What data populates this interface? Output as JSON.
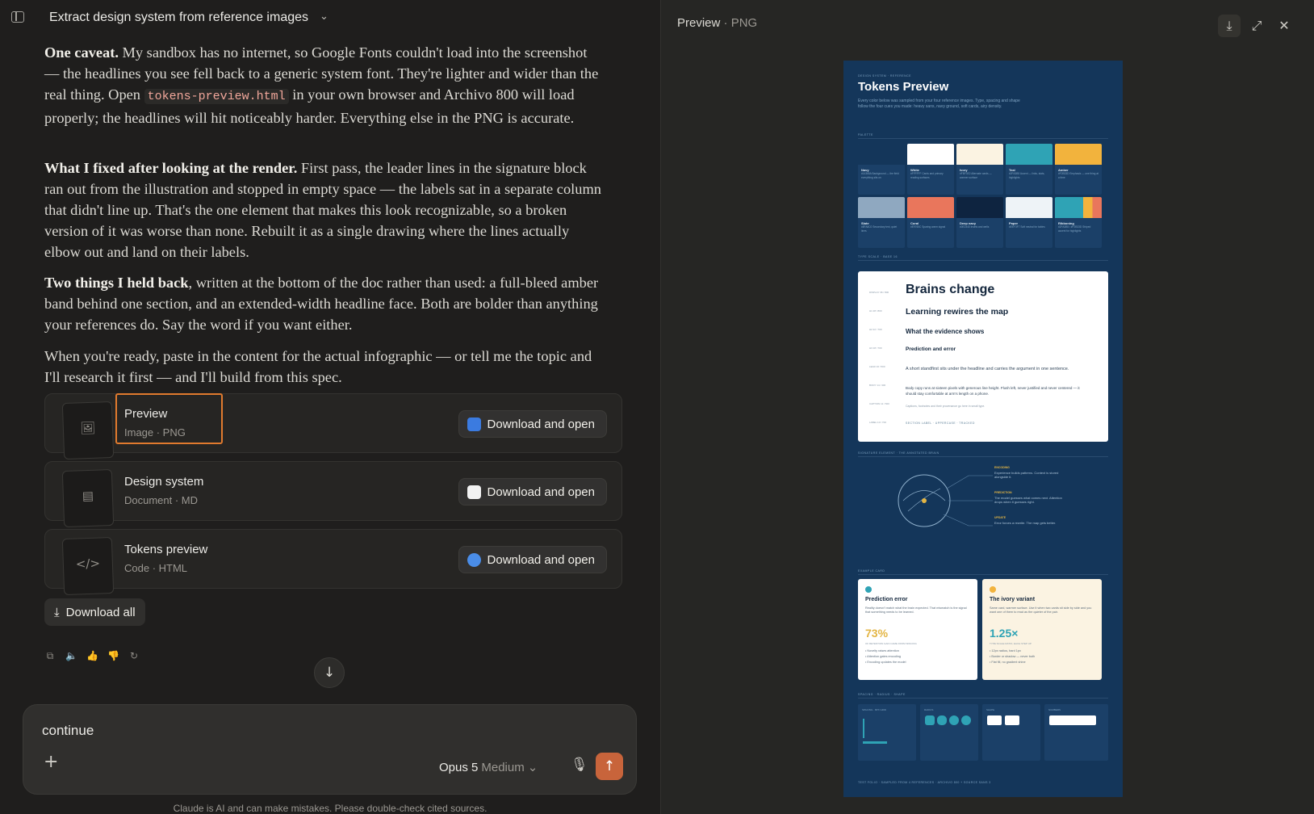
{
  "header": {
    "title": "Extract design system from reference images"
  },
  "messages": {
    "p1": {
      "lead": "One caveat.",
      "pre": " My sandbox has no internet, so Google Fonts couldn't load into the screenshot — the headlines you see fell back to a generic system font. They're lighter and wider than the real thing. Open ",
      "code": "tokens-preview.html",
      "post": " in your own browser and Archivo 800 will load properly; the headlines will hit noticeably harder. Everything else in the PNG is accurate."
    },
    "p2": {
      "lead": "What I fixed after looking at the render.",
      "body": " First pass, the leader lines in the signature block ran out from the illustration and stopped in empty space — the labels sat in a separate column that didn't line up. That's the one element that makes this look recognizable, so a broken version of it was worse than none. Rebuilt it as a single drawing where the lines actually elbow out and land on their labels."
    },
    "p3": {
      "lead": "Two things I held back",
      "body": ", written at the bottom of the doc rather than used: a full-bleed amber band behind one section, and an extended-width headline face. Both are bolder than anything your references do. Say the word if you want either."
    },
    "p4": {
      "body": "When you're ready, paste in the content for the actual infographic — or tell me the topic and I'll research it first — and I'll build from this spec."
    }
  },
  "files": [
    {
      "name": "Preview",
      "meta": "Image · PNG",
      "thumb_icon": "image-icon",
      "button": "Download and open",
      "app_color": "#3b7be0"
    },
    {
      "name": "Design system",
      "meta": "Document · MD",
      "thumb_icon": "document-icon",
      "button": "Download and open",
      "app_color": "#f2f2f2"
    },
    {
      "name": "Tokens preview",
      "meta": "Code · HTML",
      "thumb_icon": "code-icon",
      "button": "Download and open",
      "app_color": "#4a8de8"
    }
  ],
  "download_all": "Download all",
  "composer": {
    "value": "continue",
    "model": "Opus 5",
    "effort": "Medium"
  },
  "disclaimer": "Claude is AI and can make mistakes. Please double-check cited sources.",
  "preview_panel": {
    "title": "Preview",
    "subtitle": "PNG"
  },
  "poster": {
    "eyebrow": "DESIGN SYSTEM · REFERENCE",
    "title": "Tokens Preview",
    "intro": "Every color below was sampled from your four reference images. Type, spacing and shape follow the four cues you made: heavy sans, navy ground, soft cards, airy density.",
    "palette_label": "PALETTE",
    "swatches": [
      {
        "name": "Navy",
        "hex": "#14365A",
        "desc": "Background — the field everything sits on",
        "color": "#14365a"
      },
      {
        "name": "White",
        "hex": "#FFFFFF",
        "desc": "Cards and primary reading surfaces",
        "color": "#ffffff"
      },
      {
        "name": "Ivory",
        "hex": "#FBF3E2",
        "desc": "Alternate cards — warmer surface",
        "color": "#fbf3e2"
      },
      {
        "name": "Teal",
        "hex": "#2FA3B5",
        "desc": "Accent — links, stats, highlights",
        "color": "#2fa3b5"
      },
      {
        "name": "Amber",
        "hex": "#F2B33D",
        "desc": "Emphasis — one thing at a time",
        "color": "#f2b33d"
      },
      {
        "name": "Slate",
        "hex": "#8FA8C0",
        "desc": "Secondary text, quiet lines",
        "color": "#8fa8c0"
      },
      {
        "name": "Coral",
        "hex": "#E9765C",
        "desc": "Sparing warm signal",
        "color": "#e9765c"
      },
      {
        "name": "Deep navy",
        "hex": "#0E2440",
        "desc": "Insets and wells",
        "color": "#0e2440"
      },
      {
        "name": "Paper",
        "hex": "#EEF3F7",
        "desc": "Soft neutral for tables",
        "color": "#eef3f7"
      },
      {
        "name": "Ribboning",
        "hex": "#2FA3B5 / #F2B33D",
        "desc": "Striped accent for highlights",
        "color": "#2fa3b5"
      }
    ],
    "type_label": "TYPE SCALE · BASE 16",
    "type_sides": [
      "DISPLAY 36 / 800",
      "H1 28 / 800",
      "H2 22 / 700",
      "H3 18 / 700",
      "LEAD 16 / 500",
      "BODY 14 / 400",
      "CAPTION 11 / 500",
      "LABEL 10 / 700"
    ],
    "type_h1": "Brains change",
    "type_h2": "Learning rewires the map",
    "type_h3": "What the evidence shows",
    "type_h4": "Prediction and error",
    "type_lead": "A short standfirst sits under the headline and carries the argument in one sentence.",
    "type_body": "Body copy runs at sixteen pixels with generous line height. Flush left, never justified and never centered — it should stay comfortable at arm's length on a phone.",
    "type_caption": "Captions, footnotes and their provenance go here in small type.",
    "type_label_text": "SECTION LABEL · UPPERCASE · TRACKED",
    "signature_label": "SIGNATURE ELEMENT · THE ANNOTATED BRAIN",
    "signature_labels": [
      {
        "head": "ENCODING",
        "text": "Experience builds patterns. Context is stored alongside it."
      },
      {
        "head": "PREDICTION",
        "text": "The model guesses what comes next. Attention drops when it guesses right."
      },
      {
        "head": "UPDATE",
        "text": "Error forces a rewrite. The map gets better."
      }
    ],
    "example_label": "EXAMPLE CARD",
    "examples": [
      {
        "title": "Prediction error",
        "text": "Reality doesn't match what the brain expected. That mismatch is the signal that something needs to be learned.",
        "stat": "73%",
        "stat_label": "OF RETENTION GAIN CAME FROM SPACING",
        "items": [
          "• Novelty raises attention",
          "• Attention gates encoding",
          "• Encoding updates the model"
        ],
        "bg": "#ffffff",
        "dot": "#2fa3b5",
        "stat_color": "#e3b544"
      },
      {
        "title": "The ivory variant",
        "text": "Same card, warmer surface. Use it when two cards sit side by side and you want one of them to read as the quieter of the pair.",
        "stat": "1.25×",
        "stat_label": "TYPE SCALE RATIO, EACH STEP UP",
        "items": [
          "• 12px radius, hard 1px",
          "• Border or shadow — never both",
          "• Flat fill, no gradient shine"
        ],
        "bg": "#fbf3e2",
        "dot": "#f2b33d",
        "stat_color": "#2fa3b5"
      }
    ],
    "ui_label": "SPACING · RADIUS · SHAPE",
    "ui_boxes": [
      "SPACING · 8PX GRID",
      "RADIUS",
      "SHAPE",
      "NUMBERS"
    ],
    "footer": "TEST FOLIO · SAMPLED FROM 4 REFERENCES · ARCHIVO 800 + SOURCE SANS 3"
  }
}
